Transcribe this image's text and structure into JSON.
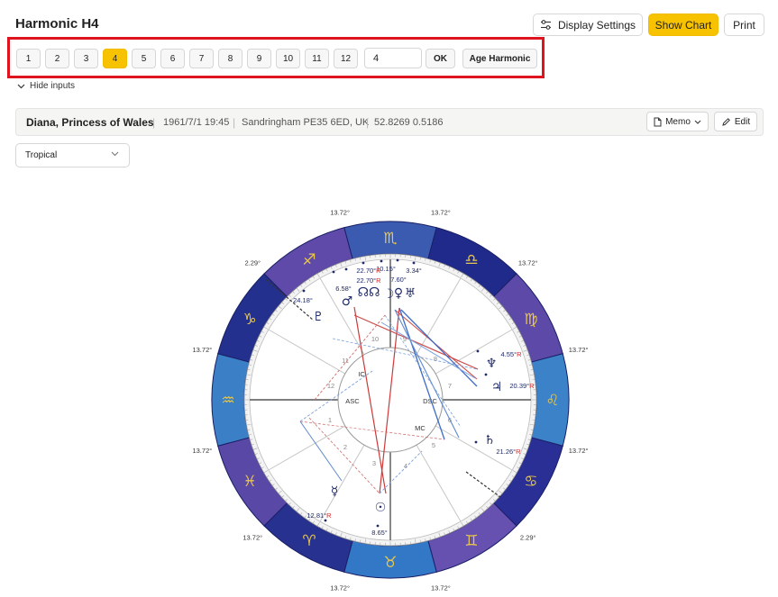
{
  "header": {
    "title": "Harmonic H4"
  },
  "toolbar": {
    "display_settings_label": "Display Settings",
    "show_chart_label": "Show Chart",
    "print_label": "Print"
  },
  "harmonics": {
    "buttons": [
      "1",
      "2",
      "3",
      "4",
      "5",
      "6",
      "7",
      "8",
      "9",
      "10",
      "11",
      "12"
    ],
    "active": "4",
    "input_value": "4",
    "ok_label": "OK",
    "age_harmonic_label": "Age Harmonic",
    "hide_inputs_label": "Hide inputs"
  },
  "subject": {
    "name": "Diana, Princess of Wales",
    "datetime": "1961/7/1 19:45",
    "place": "Sandringham PE35 6ED, UK",
    "coords": "52.8269 0.5186",
    "memo_label": "Memo",
    "edit_label": "Edit"
  },
  "zodiac_select": {
    "value": "Tropical"
  },
  "colors": {
    "accent": "#f7c300",
    "highlight_frame": "#e0141f",
    "ring_dark": "#2b3a9a",
    "ring_purple": "#5d4aa8",
    "ring_blue": "#3378c6"
  },
  "chart": {
    "sign_order_from_top_clockwise": [
      "Scorpio",
      "Libra",
      "Virgo",
      "Leo",
      "Cancer",
      "Gemini",
      "Taurus",
      "Aries",
      "Pisces",
      "Aquarius",
      "Capricorn",
      "Sagittarius"
    ],
    "sign_glyphs": [
      "♏",
      "♎",
      "♍",
      "♌",
      "♋",
      "♊",
      "♉",
      "♈",
      "♓",
      "♒",
      "♑",
      "♐"
    ],
    "cusp_degrees": [
      "13.72°",
      "13.72°",
      "13.72°",
      "13.72°",
      "13.72°",
      "2.29°",
      "13.72°",
      "13.72°",
      "13.72°",
      "13.72°",
      "13.72°",
      "2.29°"
    ],
    "angles": {
      "asc": "ASC",
      "dsc": "DSC",
      "ic": "IC",
      "mc": "MC"
    },
    "houses": [
      "1",
      "2",
      "3",
      "4",
      "5",
      "6",
      "7",
      "8",
      "9",
      "10",
      "11",
      "12"
    ],
    "planets": [
      {
        "glyph": "♂",
        "degree": "6.58°",
        "retro": ""
      },
      {
        "glyph": "☊☊",
        "degree": "22.70°",
        "retro": "R"
      },
      {
        "glyph": "☽",
        "degree": "10.15°",
        "retro": ""
      },
      {
        "glyph": "♀",
        "degree": "7.60°",
        "retro": ""
      },
      {
        "glyph": "♅",
        "degree": "3.34°",
        "retro": ""
      },
      {
        "glyph": "♆",
        "degree": "4.55°",
        "retro": "R"
      },
      {
        "glyph": "♃",
        "degree": "20.39°",
        "retro": "R"
      },
      {
        "glyph": "♄",
        "degree": "21.26°",
        "retro": "R"
      },
      {
        "glyph": "☉",
        "degree": "8.65°",
        "retro": ""
      },
      {
        "glyph": "☿",
        "degree": "12.81°",
        "retro": "R"
      },
      {
        "glyph": "♇",
        "degree": "24.18°",
        "retro": ""
      }
    ],
    "node_degree_upper": "22.70°",
    "node_retro_upper": "R"
  }
}
